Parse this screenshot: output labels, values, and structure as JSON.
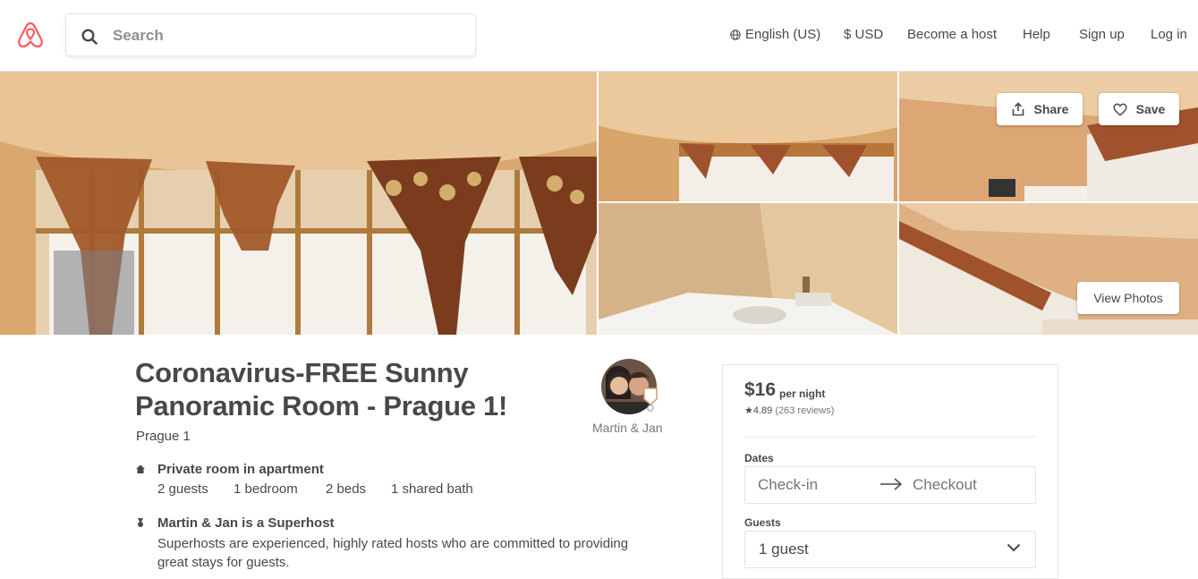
{
  "header": {
    "search_placeholder": "Search",
    "nav": {
      "language": "English (US)",
      "currency": "$ USD",
      "become_host": "Become a host",
      "help": "Help",
      "sign_up": "Sign up",
      "log_in": "Log in"
    }
  },
  "gallery": {
    "share_label": "Share",
    "save_label": "Save",
    "view_photos_label": "View Photos"
  },
  "listing": {
    "title": "Coronavirus-FREE Sunny Panoramic Room - Prague 1!",
    "location": "Prague 1",
    "host_name": "Martin & Jan",
    "room_type": "Private room in apartment",
    "guests": "2 guests",
    "bedrooms": "1 bedroom",
    "beds": "2 beds",
    "baths": "1 shared bath",
    "superhost_title": "Martin & Jan is a Superhost",
    "superhost_text": "Superhosts are experienced, highly rated hosts who are committed to providing great stays for guests."
  },
  "booking": {
    "price": "$16",
    "per_night": "per night",
    "rating": "★4.89",
    "reviews": "(263 reviews)",
    "dates_label": "Dates",
    "checkin_placeholder": "Check-in",
    "checkout_placeholder": "Checkout",
    "guests_label": "Guests",
    "guests_value": "1 guest"
  },
  "colors": {
    "brand": "#ff5a5f",
    "text": "#484848",
    "muted": "#767676"
  },
  "icons": [
    "airbnb-logo",
    "search-icon",
    "globe-icon",
    "share-icon",
    "heart-icon",
    "home-icon",
    "medal-icon",
    "arrow-right-icon",
    "chevron-down-icon"
  ]
}
